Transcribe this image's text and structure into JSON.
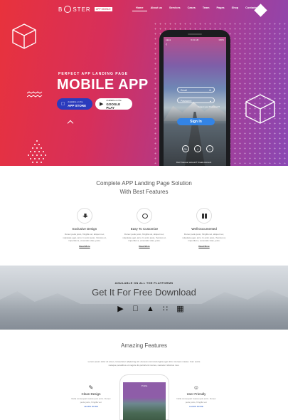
{
  "brand": {
    "logo_text": "B  STER",
    "logo_tag": "APP MOBILE"
  },
  "nav": [
    "Home",
    "About us",
    "Services",
    "Cases",
    "Team",
    "Pages",
    "Shop",
    "Contacts"
  ],
  "hero": {
    "pretitle": "PERFECT APP LANDING PAGE",
    "title": "MOBILE APP",
    "apple_small": "Available on the",
    "apple_big": "APP STORE",
    "google_small": "Available on the",
    "google_big": "GOOGLE PLAY"
  },
  "phone": {
    "status_left": "●●●●",
    "status_time": "9:41 AM",
    "status_right": "100%",
    "back": "‹",
    "email_label": "Email",
    "password_label": "Password",
    "forgot": "Forgot your Password?",
    "signin": "Sign In",
    "social": [
      "G+",
      "f",
      "t"
    ],
    "signup": "Don't have an account? Create Account"
  },
  "features": {
    "title_line1": "Complete APP Landing Page Solution",
    "title_line2": "With Best Features",
    "items": [
      {
        "name": "Exclusive Design",
        "desc": "Donec pede justo, fringilla vel, aliquet nec, vulputate eget, arcu. In enim justo, rhoncus ut, imperdiet a, venenatis vitae, justo.",
        "more": "Read More"
      },
      {
        "name": "Easy To Customize",
        "desc": "Donec pede justo, fringilla vel, aliquet nec, vulputate eget, arcu. In enim justo, rhoncus ut, imperdiet a, venenatis vitae, justo.",
        "more": "Read More"
      },
      {
        "name": "Well Documented",
        "desc": "Donec pede justo, fringilla vel, aliquet nec, vulputate eget, arcu. In enim justo, rhoncus ut, imperdiet a, venenatis vitae, justo.",
        "more": "Read More"
      }
    ]
  },
  "platforms": {
    "available": "AVAILABLE ON ALL THE PLATFORMS",
    "title": "Get It For Free Download",
    "icons": [
      "play-store-icon",
      "apple-icon",
      "android-icon",
      "blackberry-icon",
      "windows-icon"
    ]
  },
  "amazing": {
    "title": "Amazing Features",
    "desc": "Lorem ipsum dolor sit amet, consectetur adipiscing elit. Aenean commodo ligula eget dolor. Aenean massa. Cum sociis natoque penatibus et magnis dis parturient montes, nascetur ridiculus mus.",
    "phone_label": "Profile",
    "left": {
      "name": "Clean Design",
      "desc": "Nulla consequat massa quis enim. Donec pede justo, fringilla vel.",
      "more": "LEARN MORE"
    },
    "right": {
      "name": "User Friendly",
      "desc": "Nulla consequat massa quis enim. Donec pede justo, fringilla vel.",
      "more": "LEARN MORE"
    }
  }
}
